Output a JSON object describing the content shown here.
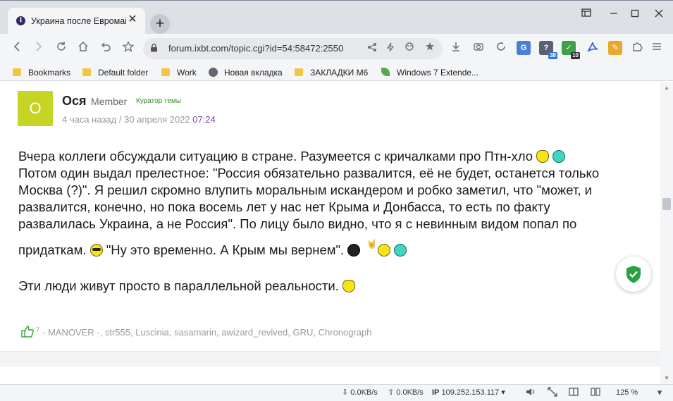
{
  "tab": {
    "title": "Украина после Евромайдана",
    "favicon_letter": "i",
    "close": "✕",
    "new_tab": "+"
  },
  "window": {
    "icons": [
      "tabs-menu-icon",
      "minimize-icon",
      "maximize-icon",
      "close-icon"
    ]
  },
  "url": {
    "text": "forum.ixbt.com/topic.cgi?id=54:58472:2550"
  },
  "extensions": [
    {
      "name": "translate-icon"
    },
    {
      "name": "addon-badge-icon",
      "badge": "38"
    },
    {
      "name": "checklist-icon",
      "badge": "10"
    },
    {
      "name": "pdf-icon"
    },
    {
      "name": "notes-icon"
    },
    {
      "name": "puzzle-icon"
    }
  ],
  "bookmarks": [
    {
      "label": "Bookmarks",
      "icon": "folder"
    },
    {
      "label": "Default folder",
      "icon": "folder"
    },
    {
      "label": "Work",
      "icon": "folder"
    },
    {
      "label": "Новая вкладка",
      "icon": "globe"
    },
    {
      "label": "ЗАКЛАДКИ М6",
      "icon": "folder"
    },
    {
      "label": "Windows 7 Extende...",
      "icon": "leaf"
    }
  ],
  "post": {
    "avatar_letter": "О",
    "username": "Ося",
    "role": "Member",
    "curator": "Куратор темы",
    "time_ago": "4 часа назад",
    "time_sep": "/",
    "date": "30 апреля 2022",
    "clock": "07:24",
    "lines": [
      "Вчера коллеги обсуждали ситуацию в стране. Разумеется с кричалками про Птн-хло",
      "Потом один выдал прелестное: \"Россия обязательно развалится, её не будет, останется только",
      "Москва (?)\". Я решил скромно влупить моральным искандером и робко заметил, что \"может, и",
      "развалится, конечно, но пока восемь лет у нас нет Крыма и Донбасса, то есть по факту",
      "развалилась Украина, а не Россия\". По лицу было видно, что я с невинным видом попал по",
      "придаткам.",
      "\"Ну это временно. А Крым мы вернем\".",
      "Эти люди живут просто в параллельной реальности."
    ],
    "likes_count": "7",
    "likes_names": "- MANOVER -, str555, Luscinia, sasamarin, awizard_revived, GRU, Chronograph"
  },
  "statusbar": {
    "download": "0.0KB/s",
    "upload": "0.0KB/s",
    "ip_label": "IP",
    "ip": "109.252.153.117",
    "zoom": "125 %"
  },
  "colors": {
    "avatar": "#c6d424",
    "curator": "#3a8a27",
    "clock": "#7a4b94",
    "shield": "#2aa141"
  }
}
